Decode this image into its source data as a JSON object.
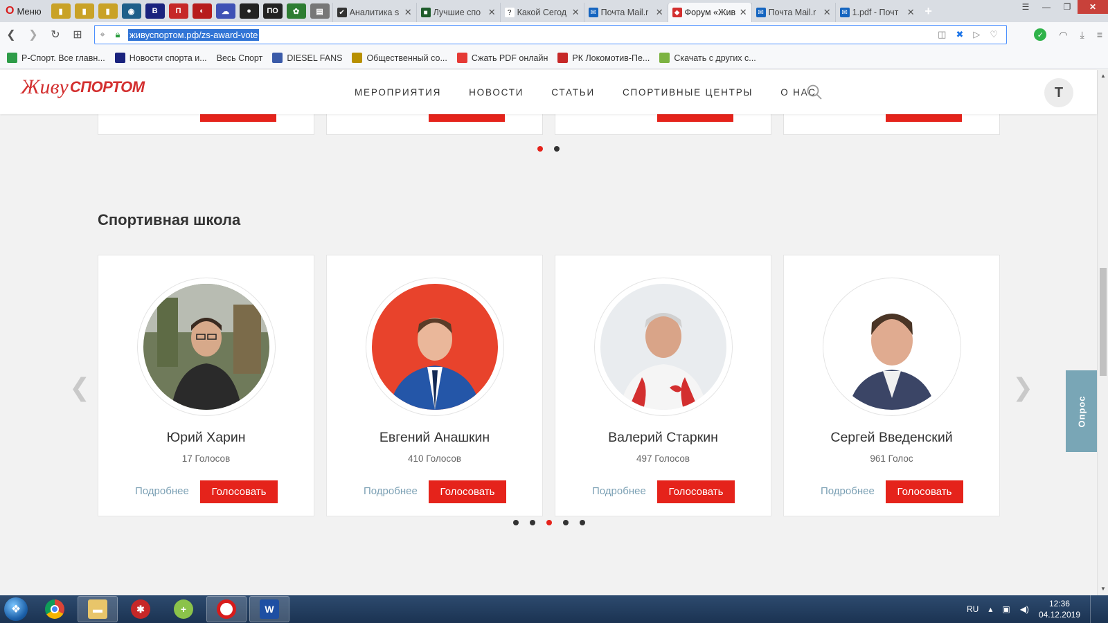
{
  "browser": {
    "menu_label": "Меню",
    "pinned_icons": [
      "pin-1",
      "pin-2",
      "pin-3",
      "pin-4",
      "pin-5",
      "pin-6",
      "pin-7",
      "pin-8",
      "pin-9",
      "pin-10",
      "pin-11"
    ],
    "tabs": [
      {
        "title": "Аналитика s",
        "color": "#333333",
        "glyph": "✔"
      },
      {
        "title": "Лучшие спо",
        "color": "#1f5c2b",
        "glyph": "■"
      },
      {
        "title": "Какой Сегод",
        "color": "#ffffff",
        "glyph": "?"
      },
      {
        "title": "Почта Mail.r",
        "color": "#1565c0",
        "glyph": "✉"
      },
      {
        "title": "Форум «Жив",
        "color": "#d32f2f",
        "glyph": "◆"
      },
      {
        "title": "Почта Mail.r",
        "color": "#1565c0",
        "glyph": "✉"
      },
      {
        "title": "1.pdf - Почт",
        "color": "#1565c0",
        "glyph": "✉"
      }
    ],
    "active_tab_index": 4,
    "url": "живуспортом.рф/zs-award-vote",
    "bookmarks": [
      {
        "label": "Р-Спорт. Все главн...",
        "color": "#2e9c48"
      },
      {
        "label": "Новости спорта и...",
        "color": "#1a237e"
      },
      {
        "label": "Весь Спорт",
        "color": ""
      },
      {
        "label": "DIESEL FANS",
        "color": "#3a5aa8"
      },
      {
        "label": "Общественный со...",
        "color": "#b89000"
      },
      {
        "label": "Сжать PDF онлайн",
        "color": "#e53935"
      },
      {
        "label": "РК Локомотив-Пе...",
        "color": "#c62828"
      },
      {
        "label": "Скачать с других с...",
        "color": "#7cb342"
      }
    ]
  },
  "site": {
    "logo_script": "Живу",
    "logo_text": "СПОРТОМ",
    "nav": [
      "МЕРОПРИЯТИЯ",
      "НОВОСТИ",
      "СТАТЬИ",
      "СПОРТИВНЫЕ ЦЕНТРЫ",
      "О НАС"
    ],
    "user_initial": "Т",
    "accent": "#e5231b",
    "link_color": "#7ba0b4"
  },
  "prev_section": {
    "dots": {
      "count": 2,
      "active": 0
    }
  },
  "section": {
    "title": "Спортивная школа",
    "more_label": "Подробнее",
    "vote_label": "Голосовать",
    "cards": [
      {
        "name": "Юрий Харин",
        "votes": "17 Голосов"
      },
      {
        "name": "Евгений Анашкин",
        "votes": "410 Голосов"
      },
      {
        "name": "Валерий Старкин",
        "votes": "497 Голосов"
      },
      {
        "name": "Сергей Введенский",
        "votes": "961 Голос"
      }
    ],
    "dots": {
      "count": 5,
      "active": 2
    }
  },
  "survey_label": "Опрос",
  "taskbar": {
    "lang": "RU",
    "time": "12:36",
    "date": "04.12.2019"
  }
}
